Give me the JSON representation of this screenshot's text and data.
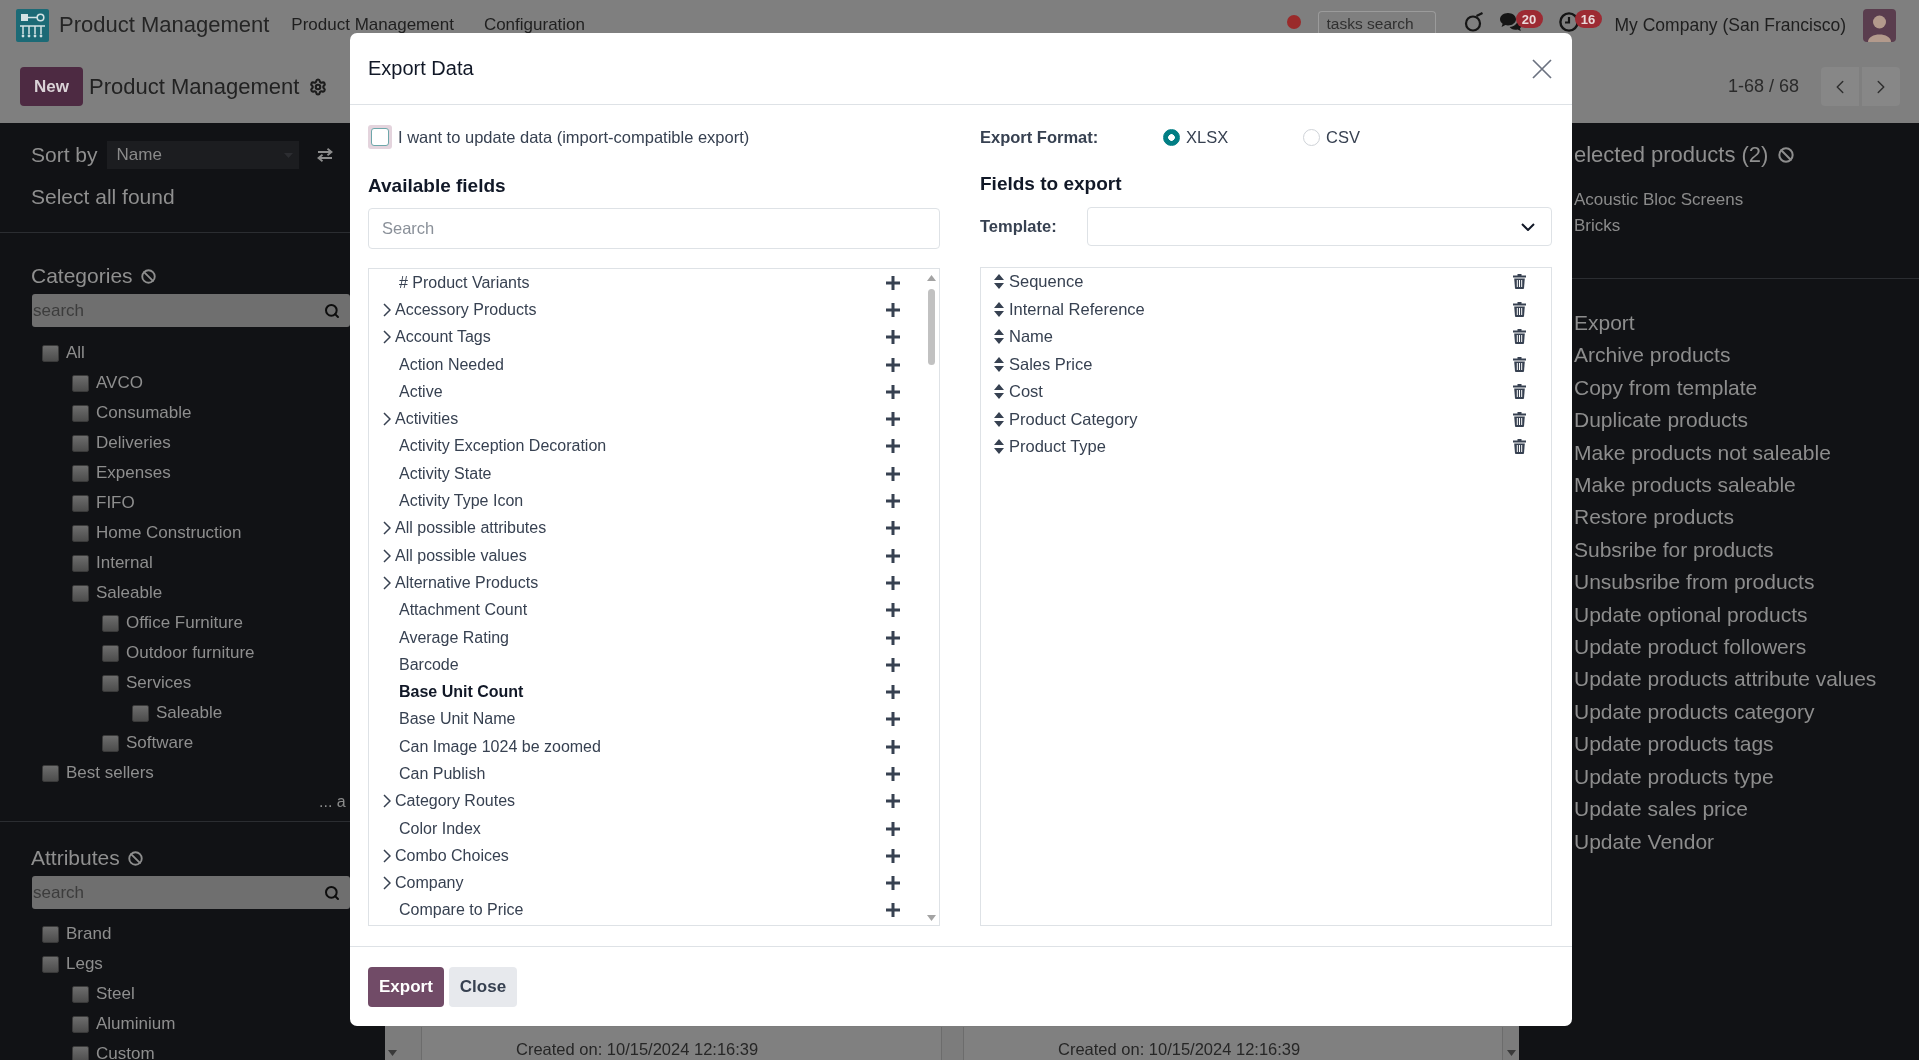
{
  "navbar": {
    "app_name": "Product Management",
    "menu": [
      "Product Management",
      "Configuration"
    ],
    "search_placeholder": "tasks search",
    "messages_badge": "20",
    "activities_badge": "16",
    "company": "My Company (San Francisco)"
  },
  "control_panel": {
    "new_button": "New",
    "breadcrumb": "Product Management",
    "pager": "1-68 / 68"
  },
  "sidebar": {
    "sort_label": "Sort by",
    "sort_value": "Name",
    "select_all": "Select all found",
    "categories": {
      "title": "Categories",
      "search_placeholder": "search",
      "tree": [
        {
          "label": "All",
          "checked": false,
          "children": [
            {
              "label": "AVCO",
              "checked": false
            },
            {
              "label": "Consumable",
              "checked": false
            },
            {
              "label": "Deliveries",
              "checked": false
            },
            {
              "label": "Expenses",
              "checked": false
            },
            {
              "label": "FIFO",
              "checked": false
            },
            {
              "label": "Home Construction",
              "checked": false
            },
            {
              "label": "Internal",
              "checked": false
            },
            {
              "label": "Saleable",
              "checked": false,
              "children": [
                {
                  "label": "Office Furniture",
                  "checked": false
                },
                {
                  "label": "Outdoor furniture",
                  "checked": false
                },
                {
                  "label": "Services",
                  "checked": false,
                  "children": [
                    {
                      "label": "Saleable",
                      "checked": false
                    }
                  ]
                },
                {
                  "label": "Software",
                  "checked": false
                }
              ]
            }
          ]
        },
        {
          "label": "Best sellers",
          "checked": false
        }
      ],
      "more": "... a"
    },
    "attributes": {
      "title": "Attributes",
      "search_placeholder": "search",
      "tree": [
        {
          "label": "Brand",
          "checked": false
        },
        {
          "label": "Legs",
          "checked": false,
          "children": [
            {
              "label": "Steel",
              "checked": false
            },
            {
              "label": "Aluminium",
              "checked": false
            },
            {
              "label": "Custom",
              "checked": false
            }
          ]
        }
      ]
    }
  },
  "selection_panel": {
    "title": "elected products (2)",
    "products": [
      "Acoustic Bloc Screens",
      "Bricks"
    ],
    "actions": [
      "Export",
      "Archive products",
      "Copy from template",
      "Duplicate products",
      "Make products not saleable",
      "Make products saleable",
      "Restore products",
      "Subsribe for products",
      "Unsubsribe from products",
      "Update optional products",
      "Update product followers",
      "Update products attribute values",
      "Update products category",
      "Update products tags",
      "Update products type",
      "Update sales price",
      "Update Vendor"
    ]
  },
  "kanban": {
    "cards": [
      {
        "created": "Created on: 10/15/2024 12:16:39"
      },
      {
        "created": "Created on: 10/15/2024 12:16:39"
      }
    ]
  },
  "dialog": {
    "title": "Export Data",
    "update_data": {
      "label": "I want to update data (import-compatible export)",
      "checked": false
    },
    "export_format": {
      "label": "Export Format:",
      "options": [
        {
          "label": "XLSX",
          "selected": true
        },
        {
          "label": "CSV",
          "selected": false
        }
      ]
    },
    "available_fields": {
      "title": "Available fields",
      "search_placeholder": "Search",
      "fields": [
        {
          "label": "# Product Variants",
          "expandable": false,
          "required": false
        },
        {
          "label": "Accessory Products",
          "expandable": true,
          "required": false
        },
        {
          "label": "Account Tags",
          "expandable": true,
          "required": false
        },
        {
          "label": "Action Needed",
          "expandable": false,
          "required": false
        },
        {
          "label": "Active",
          "expandable": false,
          "required": false
        },
        {
          "label": "Activities",
          "expandable": true,
          "required": false
        },
        {
          "label": "Activity Exception Decoration",
          "expandable": false,
          "required": false
        },
        {
          "label": "Activity State",
          "expandable": false,
          "required": false
        },
        {
          "label": "Activity Type Icon",
          "expandable": false,
          "required": false
        },
        {
          "label": "All possible attributes",
          "expandable": true,
          "required": false
        },
        {
          "label": "All possible values",
          "expandable": true,
          "required": false
        },
        {
          "label": "Alternative Products",
          "expandable": true,
          "required": false
        },
        {
          "label": "Attachment Count",
          "expandable": false,
          "required": false
        },
        {
          "label": "Average Rating",
          "expandable": false,
          "required": false
        },
        {
          "label": "Barcode",
          "expandable": false,
          "required": false
        },
        {
          "label": "Base Unit Count",
          "expandable": false,
          "required": true
        },
        {
          "label": "Base Unit Name",
          "expandable": false,
          "required": false
        },
        {
          "label": "Can Image 1024 be zoomed",
          "expandable": false,
          "required": false
        },
        {
          "label": "Can Publish",
          "expandable": false,
          "required": false
        },
        {
          "label": "Category Routes",
          "expandable": true,
          "required": false
        },
        {
          "label": "Color Index",
          "expandable": false,
          "required": false
        },
        {
          "label": "Combo Choices",
          "expandable": true,
          "required": false
        },
        {
          "label": "Company",
          "expandable": true,
          "required": false
        },
        {
          "label": "Compare to Price",
          "expandable": false,
          "required": false
        }
      ]
    },
    "fields_to_export": {
      "title": "Fields to export",
      "template_label": "Template:",
      "fields": [
        "Sequence",
        "Internal Reference",
        "Name",
        "Sales Price",
        "Cost",
        "Product Category",
        "Product Type"
      ]
    },
    "buttons": [
      {
        "label": "Export",
        "kind": "primary"
      },
      {
        "label": "Close",
        "kind": "secondary"
      }
    ]
  }
}
